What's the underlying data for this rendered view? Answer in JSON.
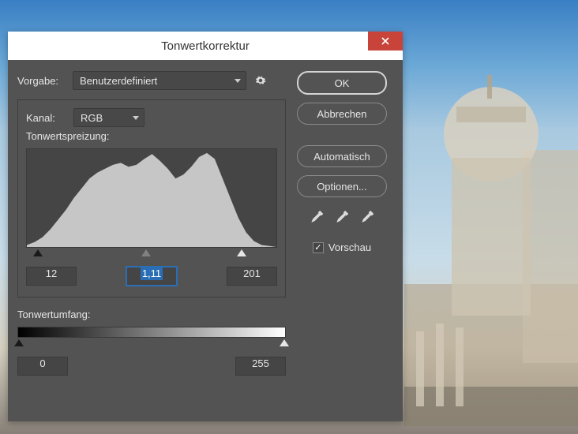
{
  "dialog": {
    "title": "Tonwertkorrektur",
    "preset_label": "Vorgabe:",
    "preset_value": "Benutzerdefiniert",
    "channel_label": "Kanal:",
    "channel_value": "RGB",
    "input_levels_label": "Tonwertspreizung:",
    "input_levels": {
      "shadow": "12",
      "midtone": "1,11",
      "highlight": "201"
    },
    "output_levels_label": "Tonwertumfang:",
    "output_levels": {
      "black": "0",
      "white": "255"
    }
  },
  "buttons": {
    "ok": "OK",
    "cancel": "Abbrechen",
    "auto": "Automatisch",
    "options": "Optionen..."
  },
  "preview": {
    "label": "Vorschau",
    "checked": true
  },
  "colors": {
    "accent": "#2a6fb5",
    "close": "#c8443b"
  },
  "chart_data": {
    "type": "area",
    "title": "",
    "xlabel": "",
    "ylabel": "",
    "xlim": [
      0,
      255
    ],
    "ylim": [
      0,
      100
    ],
    "x": [
      0,
      8,
      16,
      24,
      32,
      40,
      48,
      56,
      64,
      72,
      80,
      88,
      96,
      104,
      112,
      120,
      128,
      136,
      144,
      152,
      160,
      168,
      176,
      184,
      192,
      200,
      208,
      216,
      224,
      232,
      240,
      248,
      255
    ],
    "values": [
      2,
      5,
      10,
      18,
      28,
      38,
      50,
      60,
      70,
      76,
      80,
      84,
      86,
      82,
      84,
      90,
      95,
      88,
      80,
      70,
      74,
      82,
      92,
      96,
      90,
      70,
      50,
      30,
      15,
      6,
      2,
      1,
      0
    ]
  }
}
